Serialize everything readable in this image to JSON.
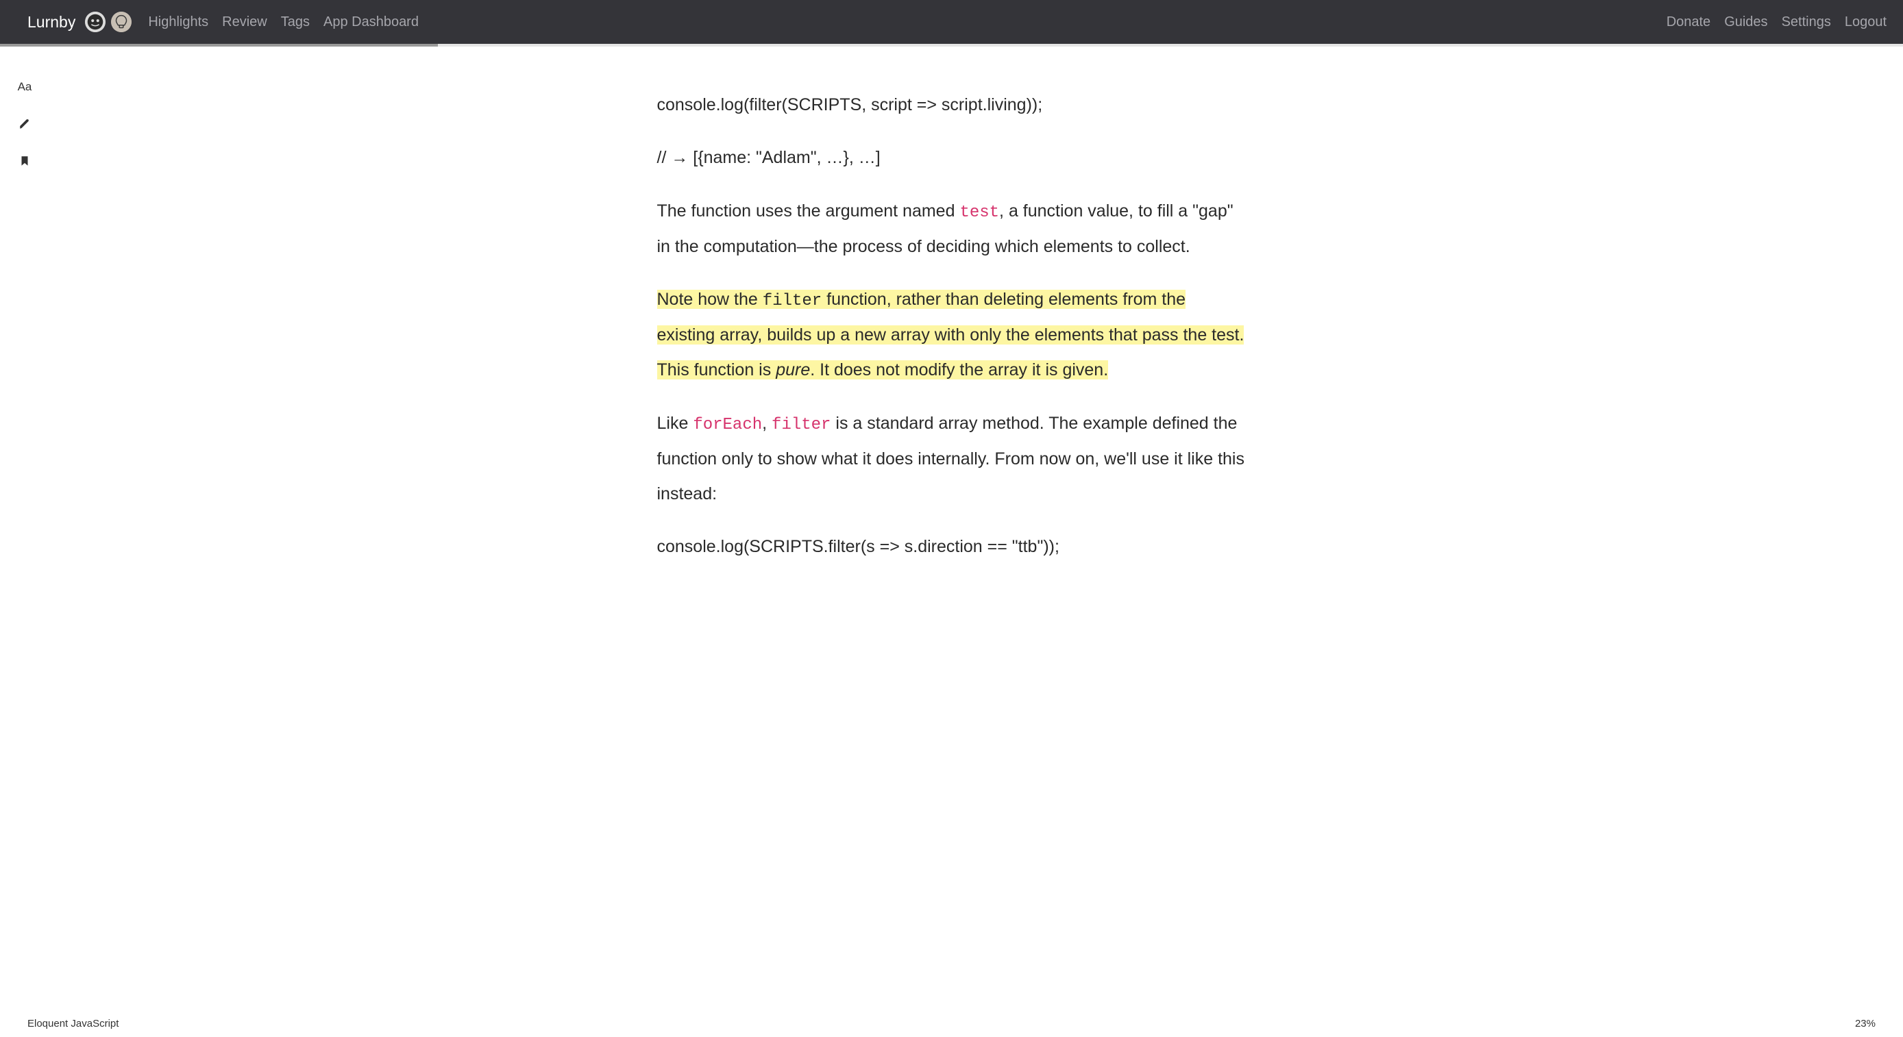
{
  "header": {
    "brand": "Lurnby",
    "nav_left": {
      "highlights": "Highlights",
      "review": "Review",
      "tags": "Tags",
      "dashboard": "App Dashboard"
    },
    "nav_right": {
      "donate": "Donate",
      "guides": "Guides",
      "settings": "Settings",
      "logout": "Logout"
    }
  },
  "progress": {
    "percent": 23,
    "percent_label": "23%"
  },
  "sidebar": {
    "text_tool_label": "Aa"
  },
  "article": {
    "code1_line1": "console.log(filter(SCRIPTS, script => script.living));",
    "code1_line2": "// → [{name: \"Adlam\", …}, …]",
    "para1_pre": "The function uses the argument named ",
    "para1_code": "test",
    "para1_post": ", a function value, to fill a \"gap\" in the computation—the process of deciding which elements to collect.",
    "para2_pre": "Note how the ",
    "para2_code": "filter",
    "para2_mid": " function, rather than deleting elements from the existing array, builds up a new array with only the elements that pass the test. This function is ",
    "para2_pure": "pure",
    "para2_post": ". It does not modify the array it is given.",
    "para3_pre": "Like ",
    "para3_code1": "forEach",
    "para3_sep": ", ",
    "para3_code2": "filter",
    "para3_post": " is a standard array method. The example defined the function only to show what it does internally. From now on, we'll use it like this instead:",
    "code2_line1": "console.log(SCRIPTS.filter(s => s.direction == \"ttb\"));"
  },
  "footer": {
    "title": "Eloquent JavaScript"
  }
}
